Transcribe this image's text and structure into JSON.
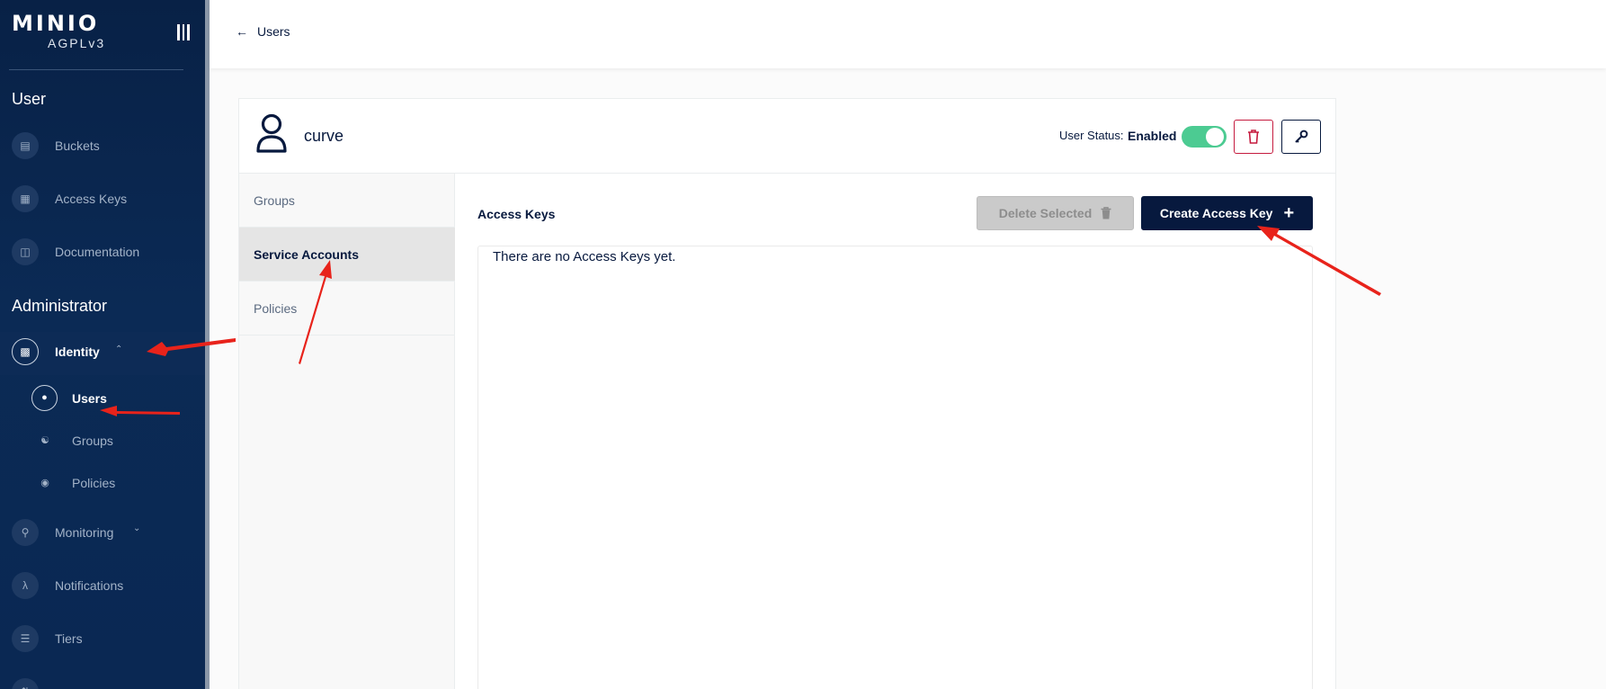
{
  "sidebar": {
    "logo": "MINIO",
    "license": "AGPLv3",
    "user_section": "User",
    "user_items": [
      {
        "label": "Buckets",
        "icon": "bucket-icon"
      },
      {
        "label": "Access Keys",
        "icon": "access-keys-icon"
      },
      {
        "label": "Documentation",
        "icon": "documentation-icon"
      }
    ],
    "admin_section": "Administrator",
    "identity": {
      "label": "Identity",
      "icon": "identity-icon"
    },
    "identity_sub": [
      {
        "label": "Users",
        "icon": "user-icon"
      },
      {
        "label": "Groups",
        "icon": "groups-icon"
      },
      {
        "label": "Policies",
        "icon": "policy-icon"
      }
    ],
    "admin_items": [
      {
        "label": "Monitoring",
        "icon": "monitoring-icon"
      },
      {
        "label": "Notifications",
        "icon": "lambda-icon"
      },
      {
        "label": "Tiers",
        "icon": "tiers-icon"
      }
    ]
  },
  "topbar": {
    "back_label": "Users"
  },
  "user": {
    "name": "curve",
    "status_label": "User Status:",
    "status_value": "Enabled",
    "enabled": true
  },
  "tabs": [
    {
      "label": "Groups",
      "active": false
    },
    {
      "label": "Service Accounts",
      "active": true
    },
    {
      "label": "Policies",
      "active": false
    }
  ],
  "access_keys": {
    "title": "Access Keys",
    "delete_selected_label": "Delete Selected",
    "create_label": "Create Access Key",
    "empty_message": "There are no Access Keys yet."
  },
  "colors": {
    "sidebar_bg": "#082146",
    "primary": "#07193e",
    "toggle_on": "#4ccb92",
    "danger": "#c51b3f",
    "annotation": "#e8231b"
  }
}
